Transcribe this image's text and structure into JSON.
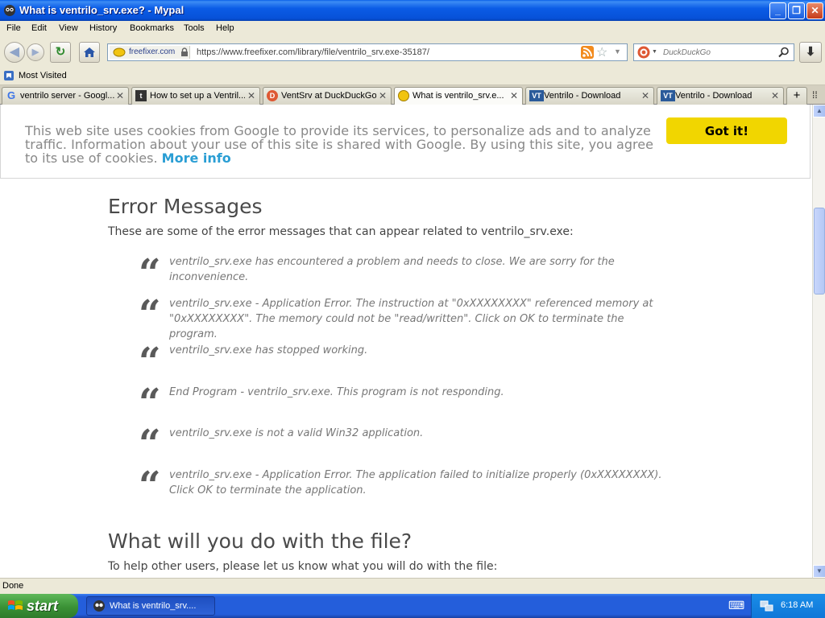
{
  "window": {
    "title": "What is ventrilo_srv.exe? - Mypal"
  },
  "menu": [
    "File",
    "Edit",
    "View",
    "History",
    "Bookmarks",
    "Tools",
    "Help"
  ],
  "address": {
    "site_name": "freefixer.com",
    "url": "https://www.freefixer.com/library/file/ventrilo_srv.exe-35187/"
  },
  "search": {
    "placeholder": "DuckDuckGo"
  },
  "bookmarks": {
    "most_visited": "Most Visited"
  },
  "tabs": [
    {
      "label": "ventrilo server - Googl...",
      "icon": "google-icon"
    },
    {
      "label": "How to set up a Ventril...",
      "icon": "t-icon"
    },
    {
      "label": "VentSrv at DuckDuckGo",
      "icon": "duckduckgo-icon"
    },
    {
      "label": "What is ventrilo_srv.e...",
      "icon": "freefixer-icon",
      "active": true
    },
    {
      "label": "Ventrilo - Download",
      "icon": "ventrilo-icon"
    },
    {
      "label": "Ventrilo - Download",
      "icon": "ventrilo-icon"
    }
  ],
  "cookie": {
    "message": "This web site uses cookies from Google to provide its services, to personalize ads and to analyze traffic. Information about your use of this site is shared with Google. By using this site, you agree to its use of cookies.",
    "more_info": "More info",
    "button": "Got it!"
  },
  "errors_section": {
    "heading": "Error Messages",
    "intro": "These are some of the error messages that can appear related to ventrilo_srv.exe:",
    "messages": [
      "ventrilo_srv.exe has encountered a problem and needs to close. We are sorry for the inconvenience.",
      "ventrilo_srv.exe - Application Error. The instruction at \"0xXXXXXXXX\" referenced memory at \"0xXXXXXXXX\". The memory could not be \"read/written\". Click on OK to terminate the program.",
      "ventrilo_srv.exe has stopped working.",
      "End Program - ventrilo_srv.exe. This program is not responding.",
      "ventrilo_srv.exe is not a valid Win32 application.",
      "ventrilo_srv.exe - Application Error. The application failed to initialize properly (0xXXXXXXXX). Click OK to terminate the application."
    ]
  },
  "file_section": {
    "heading": "What will you do with the file?",
    "intro": "To help other users, please let us know what you will do with the file:"
  },
  "status": {
    "text": "Done"
  },
  "taskbar": {
    "start": "start",
    "task": "What is ventrilo_srv....",
    "clock": "6:18 AM"
  },
  "colors": {
    "accent_cookie_button": "#f1d600",
    "link": "#2a9ed4",
    "title_bar": "#0b5ce6"
  }
}
